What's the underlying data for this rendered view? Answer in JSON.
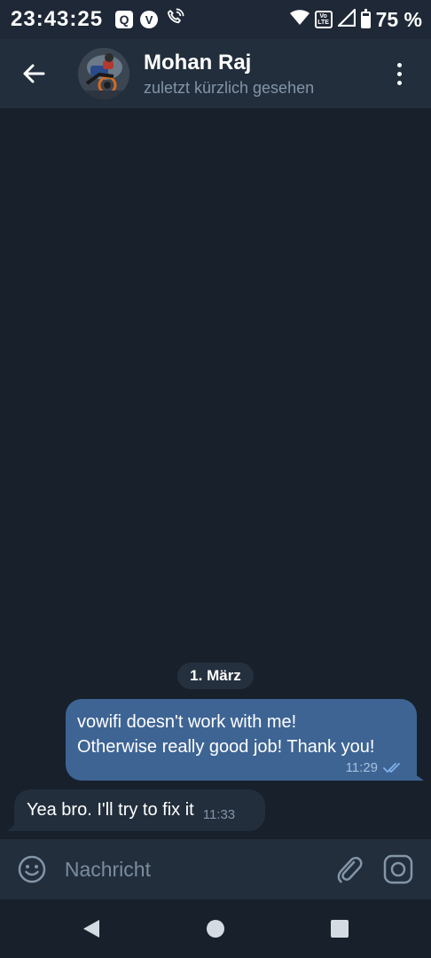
{
  "status_bar": {
    "time": "23:43:25",
    "left_icons": [
      {
        "name": "q-app-icon",
        "glyph": "Q"
      },
      {
        "name": "v-app-icon",
        "glyph": "V"
      },
      {
        "name": "wifi-calling-icon"
      }
    ],
    "volte_line1": "Vo",
    "volte_line2": "LTE",
    "battery_percent": "75 %",
    "battery_level": 0.75
  },
  "header": {
    "back_icon": "arrow-left-icon",
    "contact_name": "Mohan Raj",
    "contact_status": "zuletzt kürzlich gesehen",
    "menu_icon": "more-vertical-icon"
  },
  "chat": {
    "date_separator": "1. März",
    "messages": [
      {
        "direction": "outgoing",
        "lines": [
          "vowifi doesn't work with me!",
          "Otherwise really good job!  Thank you!"
        ],
        "time": "11:29",
        "status_icon": "double-check-icon"
      },
      {
        "direction": "incoming",
        "text": "Yea bro. I'll try to fix it",
        "time": "11:33"
      }
    ]
  },
  "input_bar": {
    "placeholder": "Nachricht",
    "emoji_icon": "smiley-icon",
    "attach_icon": "paperclip-icon",
    "camera_icon": "instagram-camera-icon"
  },
  "nav_bar": {
    "back_icon": "triangle-back-icon",
    "home_icon": "circle-home-icon",
    "recents_icon": "square-recents-icon"
  },
  "colors": {
    "background": "#17202b",
    "header": "#222e3c",
    "outgoing_bubble": "#3e6494",
    "incoming_bubble": "#222e3c",
    "check_marks": "#7fb2ea",
    "secondary_text": "#8395a8"
  }
}
